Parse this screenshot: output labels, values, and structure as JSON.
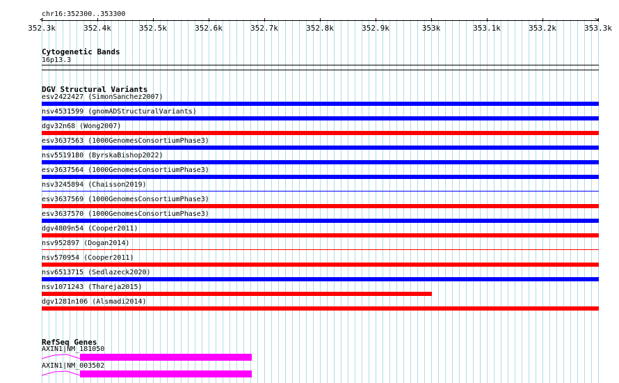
{
  "header": {
    "region": "chr16:352300..353300"
  },
  "ruler": {
    "ticks": [
      "352.3k",
      "352.4k",
      "352.5k",
      "352.6k",
      "352.7k",
      "352.8k",
      "352.9k",
      "353k",
      "353.1k",
      "353.2k",
      "353.3k"
    ]
  },
  "cytoband": {
    "title": "Cytogenetic Bands",
    "band": "16p13.3"
  },
  "dgv": {
    "title": "DGV Structural Variants",
    "colors": {
      "gain": "#0000ff",
      "loss": "#ff0000"
    },
    "variants": [
      {
        "label": "esv2422427 (SimonSanchez2007)",
        "color": "#0000ff"
      },
      {
        "label": "nsv4531599 (gnomADStructuralVariants)",
        "color": "#0000ff"
      },
      {
        "label": "dgv32n68 (Wong2007)",
        "color": "#ff0000"
      },
      {
        "label": "esv3637563 (1000GenomesConsortiumPhase3)",
        "color": "#0000ff"
      },
      {
        "label": "nsv5519180 (ByrskaBishop2022)",
        "color": "#0000ff"
      },
      {
        "label": "esv3637564 (1000GenomesConsortiumPhase3)",
        "color": "#0000ff"
      },
      {
        "label": "nsv3245894 (Chaisson2019)",
        "color": "#0000ff"
      },
      {
        "label": "esv3637569 (1000GenomesConsortiumPhase3)",
        "color": "#ff0000"
      },
      {
        "label": "esv3637570 (1000GenomesConsortiumPhase3)",
        "color": "#0000ff"
      },
      {
        "label": "dgv4809n54 (Cooper2011)",
        "color": "#ff0000"
      },
      {
        "label": "nsv952897 (Dogan2014)",
        "color": "#ff0000"
      },
      {
        "label": "nsv570954 (Cooper2011)",
        "color": "#ff0000"
      },
      {
        "label": "nsv6513715 (Sedlazeck2020)",
        "color": "#0000ff"
      },
      {
        "label": "nsv1071243 (Thareja2015)",
        "color": "#ff0000"
      },
      {
        "label": "dgv1281n106 (Alsmadi2014)",
        "color": "#ff0000"
      }
    ]
  },
  "refseq": {
    "title": "RefSeq Genes",
    "exon_color": "#ff00ff",
    "genes": [
      {
        "label": "AXIN1|NM_181050"
      },
      {
        "label": "AXIN1|NM_003502"
      }
    ]
  }
}
